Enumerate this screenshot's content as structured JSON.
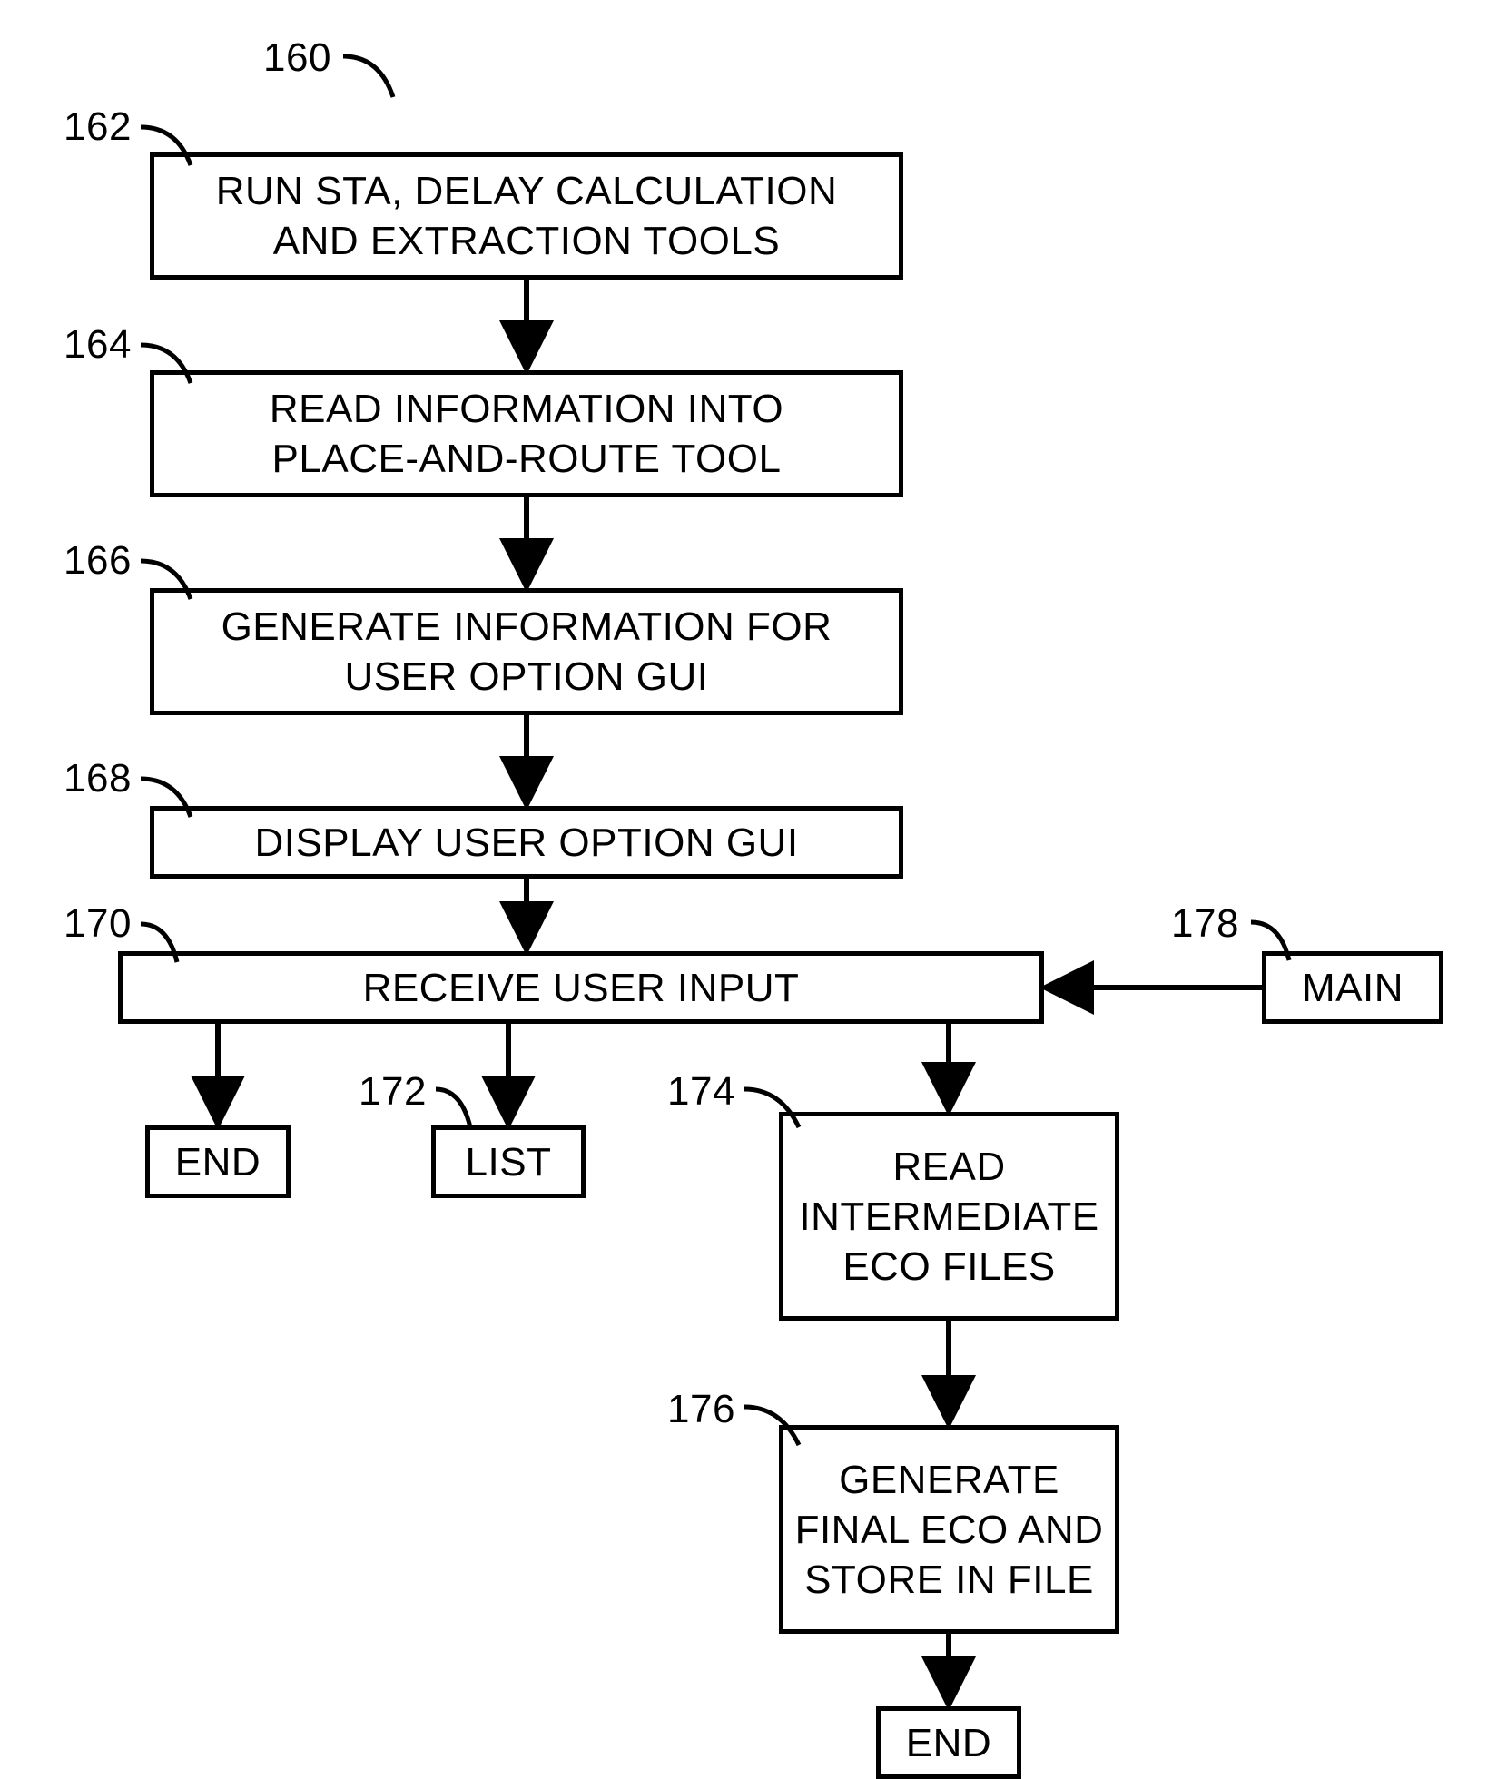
{
  "diagram": {
    "topLabel": "160",
    "boxes": {
      "b162": {
        "ref": "162",
        "text": "RUN STA, DELAY CALCULATION\nAND EXTRACTION TOOLS"
      },
      "b164": {
        "ref": "164",
        "text": "READ INFORMATION INTO\nPLACE-AND-ROUTE TOOL"
      },
      "b166": {
        "ref": "166",
        "text": "GENERATE INFORMATION FOR\nUSER OPTION GUI"
      },
      "b168": {
        "ref": "168",
        "text": "DISPLAY USER OPTION GUI"
      },
      "b170": {
        "ref": "170",
        "text": "RECEIVE USER INPUT"
      },
      "b172": {
        "ref": "172",
        "text": "LIST"
      },
      "b174": {
        "ref": "174",
        "text": "READ\nINTERMEDIATE\nECO FILES"
      },
      "b176": {
        "ref": "176",
        "text": "GENERATE\nFINAL ECO AND\nSTORE IN FILE"
      },
      "b178": {
        "ref": "178",
        "text": "MAIN"
      },
      "bEnd1": {
        "text": "END"
      },
      "bEnd2": {
        "text": "END"
      }
    }
  }
}
